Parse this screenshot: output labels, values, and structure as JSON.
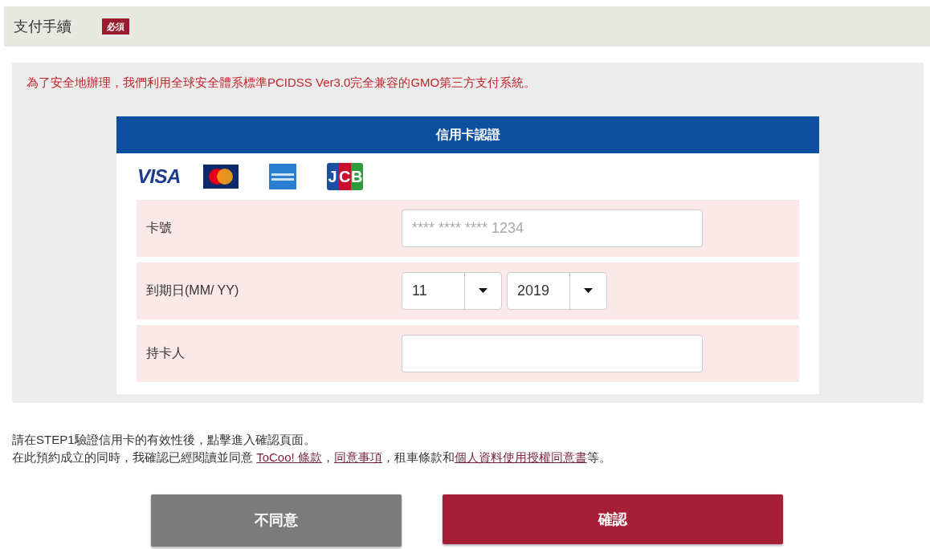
{
  "section": {
    "title": "支付手續",
    "badge": "必須"
  },
  "security_note": "為了安全地辦理，我們利用全球安全體系標準PCIDSS Ver3.0完全兼容的GMO第三方支付系統。",
  "card_form": {
    "title": "信用卡認證",
    "card_logos": [
      {
        "kind": "visa",
        "text": "VISA"
      },
      {
        "kind": "mastercard"
      },
      {
        "kind": "amex"
      },
      {
        "kind": "jcb",
        "text": "JCB"
      }
    ],
    "fields": [
      {
        "kind": "text",
        "label": "卡號",
        "placeholder": "**** **** **** 1234"
      },
      {
        "kind": "expiry",
        "label": "到期日(MM/ YY)",
        "month": "11",
        "year": "2019"
      },
      {
        "kind": "text",
        "label": "持卡人"
      }
    ]
  },
  "notes": [
    [
      {
        "kind": "text",
        "text": "請在STEP1驗證信用卡的有效性後，點擊進入確認頁面。"
      }
    ],
    [
      {
        "kind": "text",
        "text": "在此預約成立的同時，我確認已經閱讀並同意 "
      },
      {
        "kind": "link",
        "text": "ToCoo! 條款"
      },
      {
        "kind": "text",
        "text": "，"
      },
      {
        "kind": "link",
        "text": "同意事項"
      },
      {
        "kind": "text",
        "text": "，租車條款和"
      },
      {
        "kind": "link",
        "text": "個人資料使用授權同意書"
      },
      {
        "kind": "text",
        "text": "等。"
      }
    ]
  ],
  "buttons": [
    {
      "kind": "secondary",
      "label": "不同意"
    },
    {
      "kind": "primary",
      "label": "確認"
    }
  ]
}
